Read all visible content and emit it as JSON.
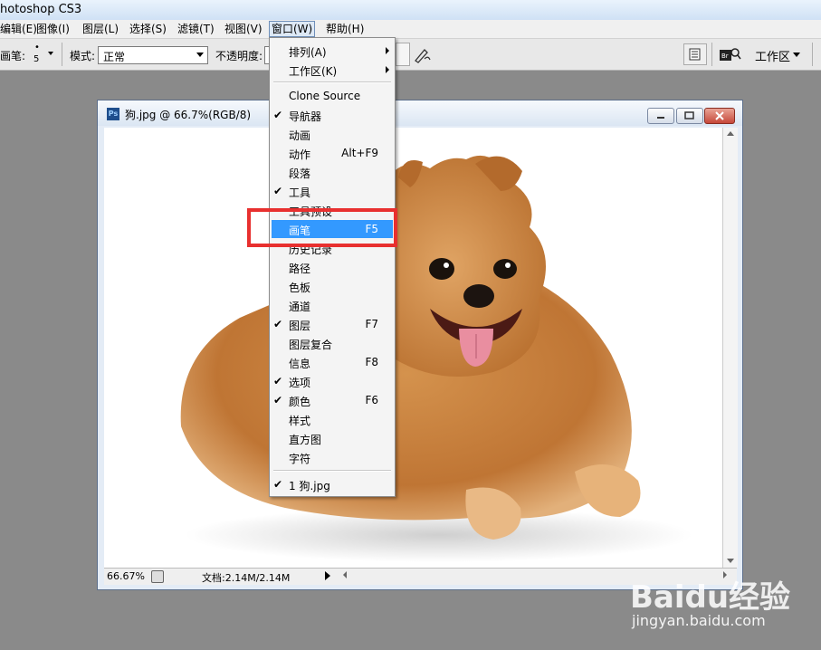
{
  "app": {
    "title": "hotoshop CS3"
  },
  "menubar": {
    "items": [
      "编辑(E)",
      "图像(I)",
      "图层(L)",
      "选择(S)",
      "滤镜(T)",
      "视图(V)",
      "窗口(W)",
      "帮助(H)"
    ],
    "active": "窗口(W)"
  },
  "options": {
    "brush_label": "画笔:",
    "brush_size": "5",
    "mode_label": "模式:",
    "mode_value": "正常",
    "opacity_label": "不透明度:",
    "workspace_label": "工作区"
  },
  "document": {
    "title": "狗.jpg @ 66.7%(RGB/8)",
    "zoom": "66.67%",
    "doc_info": "文档:2.14M/2.14M"
  },
  "window_menu": {
    "items": [
      {
        "label": "排列(A)",
        "shortcut": "",
        "checked": false,
        "submenu": true
      },
      {
        "label": "工作区(K)",
        "shortcut": "",
        "checked": false,
        "submenu": true
      },
      {
        "label": "Clone Source",
        "shortcut": "",
        "checked": false
      },
      {
        "label": "导航器",
        "shortcut": "",
        "checked": true
      },
      {
        "label": "动画",
        "shortcut": "",
        "checked": false
      },
      {
        "label": "动作",
        "shortcut": "Alt+F9",
        "checked": false
      },
      {
        "label": "段落",
        "shortcut": "",
        "checked": false
      },
      {
        "label": "工具",
        "shortcut": "",
        "checked": true
      },
      {
        "label": "工具预设",
        "shortcut": "",
        "checked": false
      },
      {
        "label": "画笔",
        "shortcut": "F5",
        "checked": false,
        "highlighted": true
      },
      {
        "label": "历史记录",
        "shortcut": "",
        "checked": false
      },
      {
        "label": "路径",
        "shortcut": "",
        "checked": false
      },
      {
        "label": "色板",
        "shortcut": "",
        "checked": false
      },
      {
        "label": "通道",
        "shortcut": "",
        "checked": false
      },
      {
        "label": "图层",
        "shortcut": "F7",
        "checked": true
      },
      {
        "label": "图层复合",
        "shortcut": "",
        "checked": false
      },
      {
        "label": "信息",
        "shortcut": "F8",
        "checked": false
      },
      {
        "label": "选项",
        "shortcut": "",
        "checked": true
      },
      {
        "label": "颜色",
        "shortcut": "F6",
        "checked": true
      },
      {
        "label": "样式",
        "shortcut": "",
        "checked": false
      },
      {
        "label": "直方图",
        "shortcut": "",
        "checked": false
      },
      {
        "label": "字符",
        "shortcut": "",
        "checked": false
      },
      {
        "label": "1 狗.jpg",
        "shortcut": "",
        "checked": true
      }
    ]
  },
  "watermark": {
    "brand": "Baidu经验",
    "site": "jingyan.baidu.com"
  },
  "colors": {
    "highlight": "#3399ff",
    "callout": "#e8302f"
  }
}
